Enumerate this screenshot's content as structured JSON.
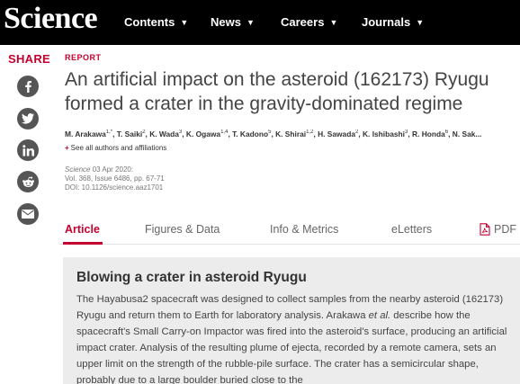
{
  "header": {
    "logo": "Science",
    "nav": [
      {
        "label": "Contents"
      },
      {
        "label": "News"
      },
      {
        "label": "Careers"
      },
      {
        "label": "Journals"
      }
    ]
  },
  "share": {
    "label": "SHARE",
    "buttons": [
      "facebook-icon",
      "twitter-icon",
      "linkedin-icon",
      "reddit-icon",
      "email-icon"
    ]
  },
  "article": {
    "type": "REPORT",
    "title": "An artificial impact on the asteroid (162173) Ryugu formed a crater in the gravity-dominated regime",
    "authors": [
      {
        "name": "M. Arakawa",
        "sup": "1,*"
      },
      {
        "name": "T. Saiki",
        "sup": "2"
      },
      {
        "name": "K. Wada",
        "sup": "3"
      },
      {
        "name": "K. Ogawa",
        "sup": "1,4"
      },
      {
        "name": "T. Kadono",
        "sup": "5"
      },
      {
        "name": "K. Shirai",
        "sup": "1,2"
      },
      {
        "name": "H. Sawada",
        "sup": "2"
      },
      {
        "name": "K. Ishibashi",
        "sup": "3"
      },
      {
        "name": "R. Honda",
        "sup": "6"
      },
      {
        "name": "N. Sak...",
        "sup": ""
      }
    ],
    "see_all": "See all authors and affiliations",
    "journal": "Science",
    "date": "03 Apr 2020:",
    "volume": "Vol. 368, Issue 6486, pp. 67-71",
    "doi": "DOI: 10.1126/science.aaz1701"
  },
  "tabs": [
    {
      "label": "Article"
    },
    {
      "label": "Figures & Data"
    },
    {
      "label": "Info & Metrics"
    },
    {
      "label": "eLetters"
    },
    {
      "label": "PDF"
    }
  ],
  "abstract": {
    "heading": "Blowing a crater in asteroid Ryugu",
    "text_before": "The Hayabusa2 spacecraft was designed to collect samples from the nearby asteroid (162173) Ryugu and return them to Earth for laboratory analysis. Arakawa ",
    "text_italic": "et al.",
    "text_after": " describe how the spacecraft's Small Carry-on Impactor was fired into the asteroid's surface, producing an artificial impact crater. Analysis of the resulting plume of ejecta, recorded by a remote camera, sets an upper limit on the strength of the rubble-pile surface. The crater has a semicircular shape, probably due to a large boulder buried close to the"
  },
  "colors": {
    "accent": "#c3002f",
    "header_bg": "#000000",
    "abstract_bg": "#ececec"
  }
}
